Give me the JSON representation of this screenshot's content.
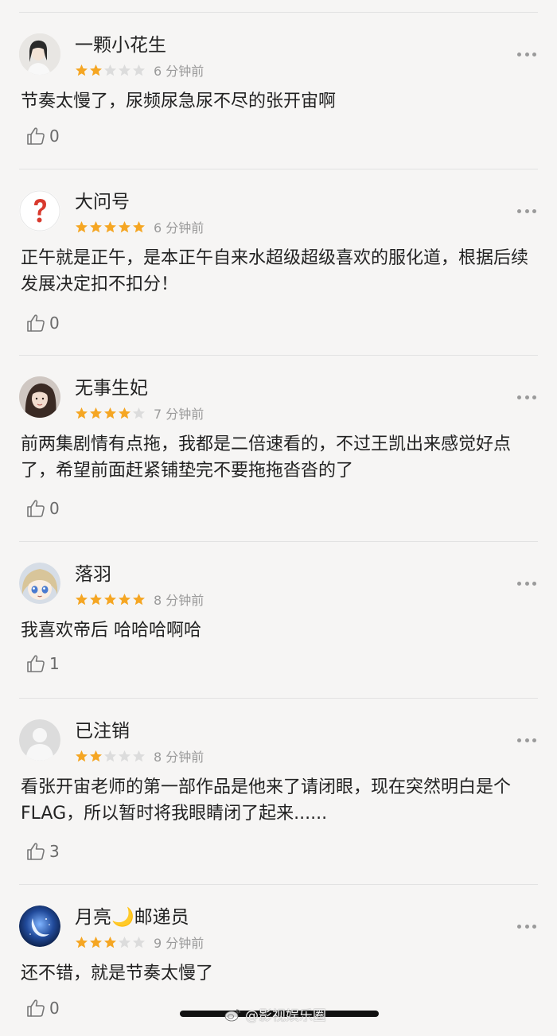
{
  "colors": {
    "star_filled": "#f5a623",
    "star_empty": "#dcdcdc",
    "meta_gray": "#9a9a9a",
    "divider": "#e2e2e2",
    "background": "#f6f5f4"
  },
  "comments": [
    {
      "username": "一颗小花生",
      "rating": 2,
      "time": "6 分钟前",
      "text": "节奏太慢了，尿频尿急尿不尽的张开宙啊",
      "likes": "0",
      "avatar": "girl-photo-avatar"
    },
    {
      "username": "大问号",
      "rating": 5,
      "time": "6 分钟前",
      "text": "正午就是正午，是本正午自来水超级超级喜欢的服化道，根据后续发展决定扣不扣分！",
      "likes": "0",
      "avatar": "question-mark-avatar"
    },
    {
      "username": "无事生妃",
      "rating": 4,
      "time": "7 分钟前",
      "text": "前两集剧情有点拖，我都是二倍速看的，不过王凯出来感觉好点了，希望前面赶紧铺垫完不要拖拖沓沓的了",
      "likes": "0",
      "avatar": "woman-photo-avatar"
    },
    {
      "username": "落羽",
      "rating": 5,
      "time": "8 分钟前",
      "text": "我喜欢帝后 哈哈哈啊哈",
      "likes": "1",
      "avatar": "anime-girl-avatar"
    },
    {
      "username": "已注销",
      "rating": 2,
      "time": "8 分钟前",
      "text": "看张开宙老师的第一部作品是他来了请闭眼，现在突然明白是个FLAG，所以暂时将我眼睛闭了起来......",
      "likes": "3",
      "avatar": "default-user-avatar"
    },
    {
      "username": "月亮🌙邮递员",
      "rating": 3,
      "time": "9 分钟前",
      "text": "还不错，就是节奏太慢了",
      "likes": "0",
      "avatar": "moon-avatar"
    }
  ],
  "watermark": {
    "text": "@影视娱乐圈",
    "icon": "weibo-logo-icon"
  }
}
